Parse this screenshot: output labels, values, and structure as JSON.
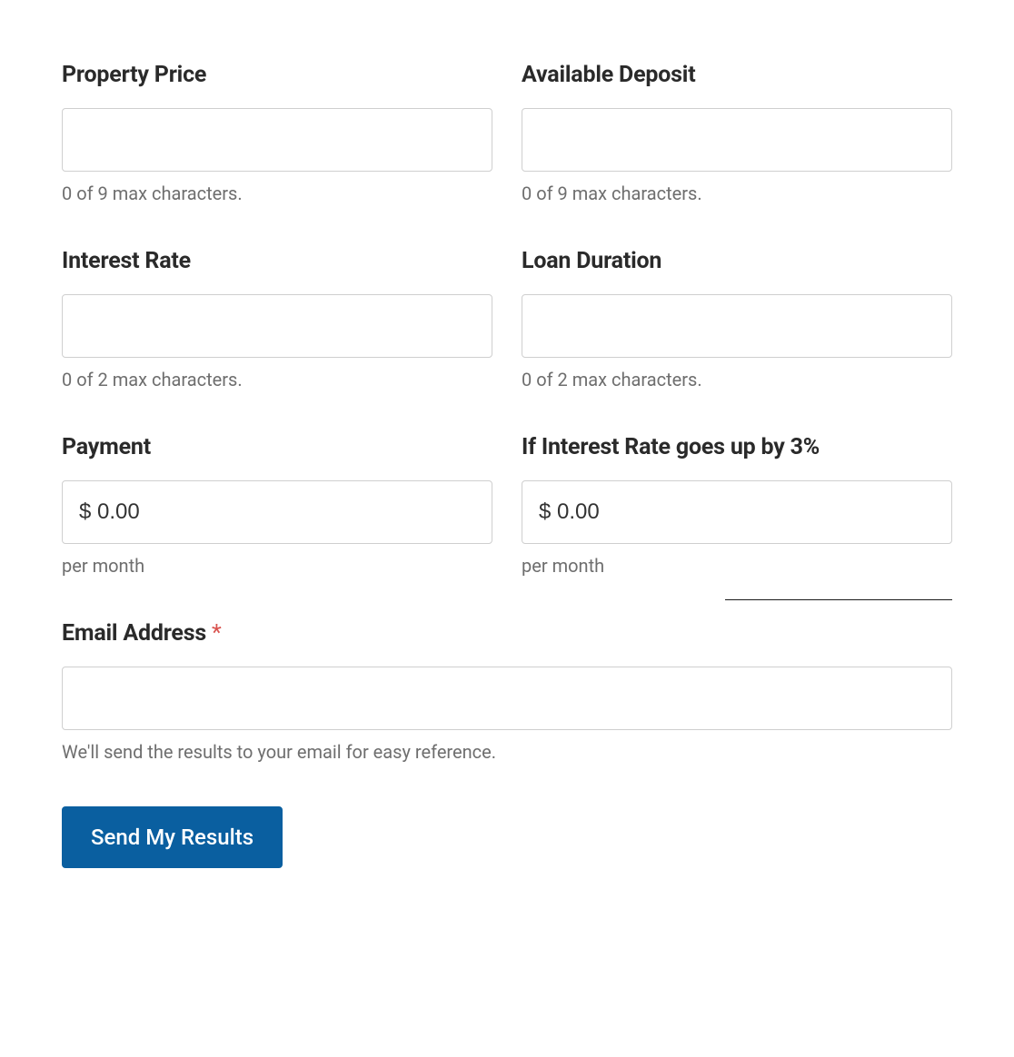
{
  "form": {
    "propertyPrice": {
      "label": "Property Price",
      "value": "",
      "help": "0 of 9 max characters."
    },
    "availableDeposit": {
      "label": "Available Deposit",
      "value": "",
      "help": "0 of 9 max characters."
    },
    "interestRate": {
      "label": "Interest Rate",
      "value": "",
      "help": "0 of 2 max characters."
    },
    "loanDuration": {
      "label": "Loan Duration",
      "value": "",
      "help": "0 of 2 max characters."
    },
    "payment": {
      "label": "Payment",
      "value": "$ 0.00",
      "help": "per month"
    },
    "paymentIfUp": {
      "label": "If Interest Rate goes up by 3%",
      "value": "$ 0.00",
      "help": "per month"
    },
    "email": {
      "label": "Email Address ",
      "requiredMark": "*",
      "value": "",
      "help": "We'll send the results to your email for easy reference."
    },
    "submit": {
      "label": "Send My Results"
    }
  }
}
